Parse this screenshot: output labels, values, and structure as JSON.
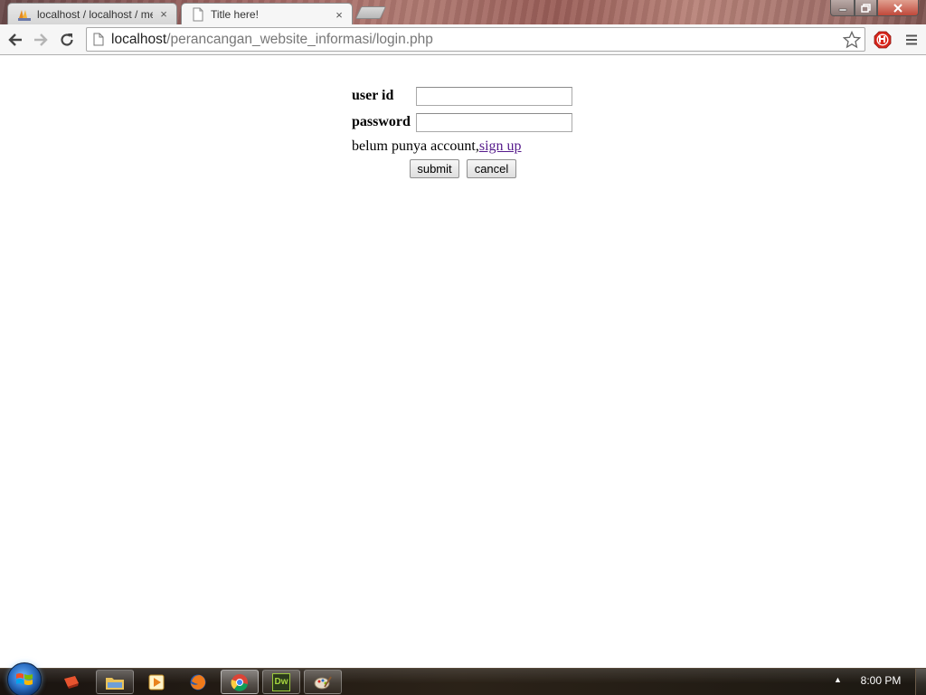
{
  "browser": {
    "tabs": [
      {
        "title": "localhost / localhost / me",
        "close": "×",
        "icon": "phpmyadmin-icon"
      },
      {
        "title": "Title here!",
        "close": "×",
        "icon": "page-icon"
      }
    ],
    "url": {
      "host": "localhost",
      "path": "/perancangan_website_informasi/login.php"
    }
  },
  "login": {
    "userid_label": "user id",
    "password_label": "password",
    "userid_value": "",
    "password_value": "",
    "signup_text": "belum punya account,",
    "signup_link": "sign up",
    "submit_label": "submit",
    "cancel_label": "cancel",
    "link_color": "#551a8b"
  },
  "taskbar": {
    "apps": [
      "sticky-note-icon",
      "file-explorer-icon",
      "media-player-icon",
      "firefox-icon",
      "chrome-icon",
      "dreamweaver-icon",
      "paint-icon"
    ],
    "dreamweaver_label": "Dw",
    "clock": "8:00 PM"
  }
}
